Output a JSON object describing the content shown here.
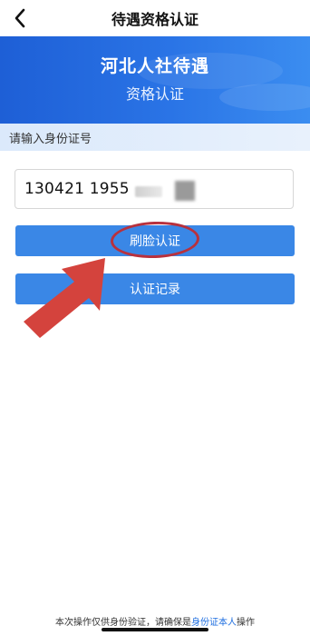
{
  "navbar": {
    "title": "待遇资格认证"
  },
  "banner": {
    "title": "河北人社待遇",
    "subtitle": "资格认证"
  },
  "form": {
    "section_label": "请输入身份证号",
    "id_value": "130421 1955"
  },
  "buttons": {
    "face_auth": "刷脸认证",
    "records": "认证记录"
  },
  "footer": {
    "prefix": "本次操作仅供身份验证，请确保是",
    "link": "身份证本人",
    "suffix": "操作"
  },
  "colors": {
    "banner": "#2a74e6",
    "button": "#3a87e6",
    "annotation": "#b8313d",
    "arrow": "#d4433d",
    "link": "#1f6fe0"
  }
}
